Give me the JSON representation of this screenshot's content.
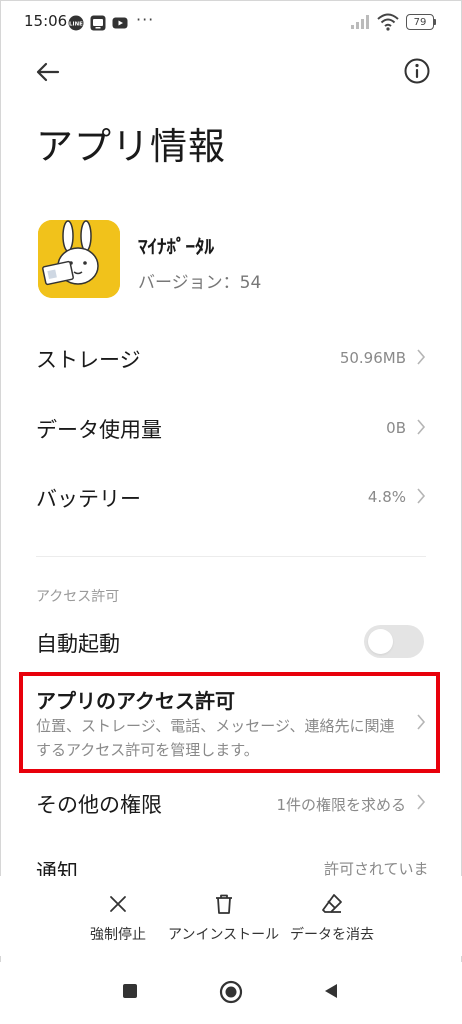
{
  "status_bar": {
    "time": "15:06",
    "dots": "···",
    "battery": "79",
    "icons": [
      "line-icon",
      "tv-icon",
      "youtube-icon",
      "signal-icon",
      "wifi-icon",
      "battery-icon"
    ]
  },
  "header": {
    "back_icon": "arrow-left-icon",
    "info_icon": "info-icon"
  },
  "page": {
    "title": "アプリ情報"
  },
  "app": {
    "name": "ﾏｲﾅﾎﾟｰﾀﾙ",
    "version": "バージョン：54",
    "icon": "mynaportal-rabbit-icon",
    "icon_color": "#f1c21b"
  },
  "rows": {
    "storage": {
      "label": "ストレージ",
      "value": "50.96MB"
    },
    "data_usage": {
      "label": "データ使用量",
      "value": "0B"
    },
    "battery": {
      "label": "バッテリー",
      "value": "4.8%"
    }
  },
  "access_section": {
    "label": "アクセス許可",
    "autostart": {
      "label": "自動起動",
      "enabled": false
    },
    "app_permissions": {
      "title": "アプリのアクセス許可",
      "description": "位置、ストレージ、電話、メッセージ、連絡先に関連するアクセス許可を管理します。"
    },
    "other_permissions": {
      "label": "その他の権限",
      "value": "1件の権限を求める"
    },
    "notifications": {
      "label": "通知",
      "value": "許可されています"
    }
  },
  "actions": {
    "force_stop": "強制停止",
    "uninstall": "アンインストール",
    "clear_data": "データを消去"
  },
  "colors": {
    "highlight": "#e8000b",
    "secondary_text": "#8a8a8a",
    "primary_text": "#1a1a1a"
  }
}
